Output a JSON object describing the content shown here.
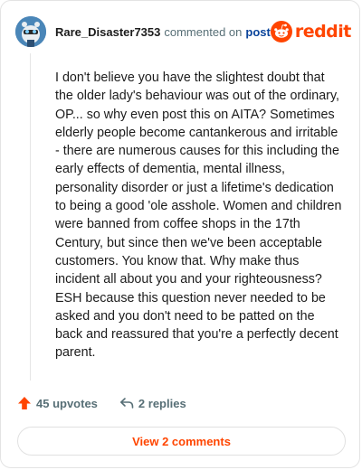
{
  "header": {
    "username": "Rare_Disaster7353",
    "action_text": "commented on",
    "post_link": "post",
    "brand": "reddit"
  },
  "comment": {
    "text": "I don't believe you have the slightest doubt that the older lady's behaviour was out of the ordinary, OP... so why even post this on AITA? Sometimes elderly people become cantankerous and irritable - there are numerous causes for this including the early effects of dementia, mental illness, personality disorder or just a lifetime's dedication to being a good 'ole asshole. Women and children were banned from coffee shops in the 17th Century, but since then we've been acceptable customers. You know that. Why make thus incident all about you and your righteousness? ESH because this question never needed to be asked and you don't need to be patted on the back and reassured that you're a perfectly decent parent."
  },
  "actions": {
    "upvotes_label": "45 upvotes",
    "replies_label": "2 replies",
    "upvote_icon": "upvote-arrow-icon",
    "reply_icon": "reply-arrow-icon"
  },
  "footer": {
    "view_comments_label": "View 2 comments"
  },
  "colors": {
    "brand_orange": "#ff4500",
    "link_blue": "#0a449b",
    "muted_text": "#576f76"
  }
}
